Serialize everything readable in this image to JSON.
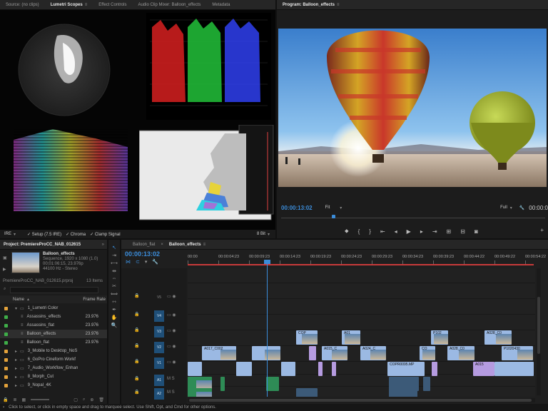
{
  "source_panel": {
    "tabs": [
      {
        "label": "Source: (no clips)",
        "active": false
      },
      {
        "label": "Lumetri Scopes",
        "active": true
      },
      {
        "label": "Effect Controls",
        "active": false
      },
      {
        "label": "Audio Clip Mixer: Balloon_effects",
        "active": false
      },
      {
        "label": "Metadata",
        "active": false
      }
    ],
    "bottom_controls": {
      "scale": "IRE",
      "setup": "Setup (7.5 IRE)",
      "chroma": "Chroma",
      "clamp": "Clamp Signal",
      "bit_depth": "8 Bit"
    }
  },
  "program_panel": {
    "title": "Program: Balloon_effects",
    "timecode": "00:00:13:02",
    "fit": "Fit",
    "quality": "Full",
    "end_timecode": "00:00:0"
  },
  "project_panel": {
    "title": "Project: PremiereProCC_NAB_012615",
    "clip_name": "Balloon_effects",
    "clip_info": [
      "Sequence, 1920 x 1080 (1.0)",
      "00;01:06:15, 23.976p",
      "44100 Hz - Stereo"
    ],
    "project_file": "PremiereProCC_NAB_012615.prproj",
    "item_count": "13 Items",
    "col_name": "Name",
    "col_rate": "Frame Rate",
    "rows": [
      {
        "name": "1_Lumetri Color",
        "rate": "",
        "color": "#e3a23b",
        "indent": 1,
        "folder": true,
        "open": true
      },
      {
        "name": "Assassins_effects",
        "rate": "23.976",
        "color": "#3fae49",
        "indent": 2,
        "folder": false
      },
      {
        "name": "Assassins_flat",
        "rate": "23.976",
        "color": "#3fae49",
        "indent": 2,
        "folder": false
      },
      {
        "name": "Balloon_effects",
        "rate": "23.976",
        "color": "#3fae49",
        "indent": 2,
        "folder": false
      },
      {
        "name": "Balloon_flat",
        "rate": "23.976",
        "color": "#3fae49",
        "indent": 2,
        "folder": false
      },
      {
        "name": "3_Mobile to Desktop_NoS",
        "rate": "",
        "color": "#e3a23b",
        "indent": 1,
        "folder": true
      },
      {
        "name": "6_GoPro Cineform Workf",
        "rate": "",
        "color": "#e3a23b",
        "indent": 1,
        "folder": true
      },
      {
        "name": "7_Audio_Workflow_Enhan",
        "rate": "",
        "color": "#e3a23b",
        "indent": 1,
        "folder": true
      },
      {
        "name": "8_Morph_Cut",
        "rate": "",
        "color": "#e3a23b",
        "indent": 1,
        "folder": true
      },
      {
        "name": "9_Nopal_4K",
        "rate": "",
        "color": "#e3a23b",
        "indent": 1,
        "folder": true
      }
    ]
  },
  "timeline": {
    "tabs": [
      {
        "label": "Balloon_flat",
        "active": false
      },
      {
        "label": "Balloon_effects",
        "active": true
      }
    ],
    "timecode": "00:00:13:02",
    "ruler": [
      "00:00",
      "00:00:04:23",
      "00:00:09:23",
      "00:00:14:23",
      "00:00:19:23",
      "00:00:24:23",
      "00:00:29:23",
      "00:00:34:23",
      "00:00:39:23",
      "00:00:44:22",
      "00:00:49:22",
      "00:00:54:22"
    ],
    "tracks": [
      "V5",
      "V4",
      "V3",
      "V2",
      "V1",
      "A1",
      "A2"
    ],
    "clips": {
      "v3": [
        "COP",
        "A01",
        "P102",
        "A028_C0"
      ],
      "v2": [
        "A017_C002",
        "A015_C",
        "A024_C",
        "CO",
        "A028_C0",
        "P1020430"
      ],
      "v1": [
        "COPR0095.MP",
        "A015"
      ]
    }
  },
  "status_bar": "Click to select, or click in empty space and drag to marquee select. Use Shift, Opt, and Cmd for other options.",
  "colors": {
    "accent": "#3b8cd9",
    "playhead": "#3b8cd9",
    "video_clip": "#9bb9e3",
    "audio_clip": "#2e8c56",
    "purple_clip": "#b59be0"
  }
}
